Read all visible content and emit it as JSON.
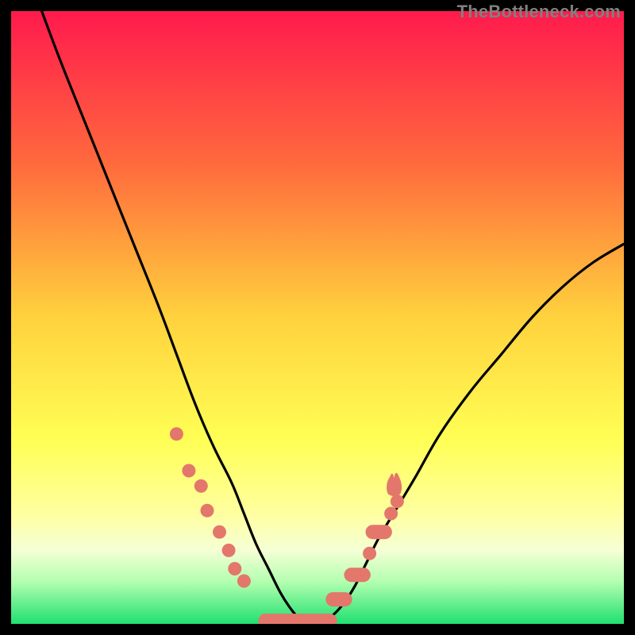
{
  "watermark": "TheBottleneck.com",
  "chart_data": {
    "type": "line",
    "title": "",
    "xlabel": "",
    "ylabel": "",
    "xlim": [
      0,
      100
    ],
    "ylim": [
      0,
      100
    ],
    "grid": false,
    "background_gradient": {
      "type": "vertical_linear",
      "stops": [
        {
          "pos": 0.0,
          "color": "#ff1a4d"
        },
        {
          "pos": 0.25,
          "color": "#ff6a3d"
        },
        {
          "pos": 0.5,
          "color": "#ffd23d"
        },
        {
          "pos": 0.7,
          "color": "#ffff55"
        },
        {
          "pos": 0.82,
          "color": "#ffffa0"
        },
        {
          "pos": 0.88,
          "color": "#f5ffd5"
        },
        {
          "pos": 0.93,
          "color": "#b5ffb0"
        },
        {
          "pos": 1.0,
          "color": "#20e070"
        }
      ]
    },
    "bottleneck_percent": {
      "left_top": 100,
      "valley_x": 47,
      "valley_min": 0,
      "right_end": 62
    },
    "series": [
      {
        "name": "bottleneck-curve",
        "x": [
          5,
          8,
          12,
          16,
          20,
          24,
          27,
          30,
          33,
          36,
          38,
          40,
          42,
          44,
          46,
          48,
          50,
          52,
          54,
          56,
          58,
          60,
          63,
          66,
          70,
          75,
          80,
          85,
          90,
          95,
          100
        ],
        "y": [
          100,
          92,
          82,
          72,
          62,
          52,
          44,
          36,
          29,
          23,
          18,
          13,
          9,
          5,
          2,
          0,
          0,
          1,
          3,
          6,
          10,
          14,
          19,
          24,
          31,
          38,
          44,
          50,
          55,
          59,
          62
        ]
      }
    ],
    "markers": {
      "name": "highlight-dots",
      "color": "#e3776b",
      "points": [
        {
          "t": "dot",
          "x": 27.0,
          "y": 31.0
        },
        {
          "t": "dot",
          "x": 29.0,
          "y": 25.0
        },
        {
          "t": "dot",
          "x": 31.0,
          "y": 22.5
        },
        {
          "t": "dot",
          "x": 32.0,
          "y": 18.5
        },
        {
          "t": "dot",
          "x": 34.0,
          "y": 15.0
        },
        {
          "t": "dot",
          "x": 35.5,
          "y": 12.0
        },
        {
          "t": "dot",
          "x": 36.5,
          "y": 9.0
        },
        {
          "t": "dot",
          "x": 38.0,
          "y": 7.0
        },
        {
          "t": "pill",
          "x1": 41.5,
          "x2": 52.0,
          "y": 0.5
        },
        {
          "t": "pill",
          "x1": 52.5,
          "x2": 54.5,
          "y": 4.0
        },
        {
          "t": "pill",
          "x1": 55.5,
          "x2": 57.5,
          "y": 8.0
        },
        {
          "t": "dot",
          "x": 58.5,
          "y": 11.5
        },
        {
          "t": "pill",
          "x1": 59.0,
          "x2": 61.0,
          "y": 15.0
        },
        {
          "t": "dot",
          "x": 62.0,
          "y": 18.0
        },
        {
          "t": "dot",
          "x": 63.0,
          "y": 20.0
        },
        {
          "t": "flame",
          "x": 62.5,
          "y": 22.0
        }
      ]
    }
  }
}
